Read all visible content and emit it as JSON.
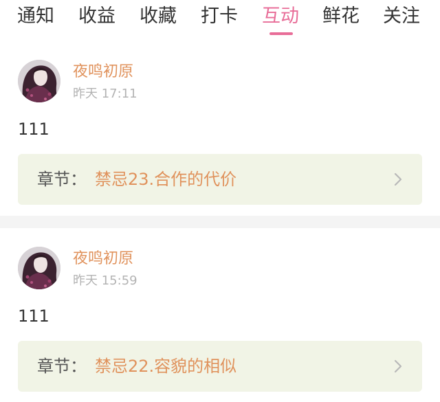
{
  "tabs": [
    {
      "label": "通知",
      "active": false
    },
    {
      "label": "收益",
      "active": false
    },
    {
      "label": "收藏",
      "active": false
    },
    {
      "label": "打卡",
      "active": false
    },
    {
      "label": "互动",
      "active": true
    },
    {
      "label": "鲜花",
      "active": false
    },
    {
      "label": "关注",
      "active": false
    }
  ],
  "colors": {
    "accent": "#e86d98",
    "username": "#e0925c",
    "chapter_title": "#e0925c",
    "chapter_bg": "#f1f4e6",
    "timestamp": "#b3b3b3"
  },
  "comments": [
    {
      "username": "夜鸣初原",
      "time": "昨天 17:11",
      "text": "111",
      "chapter_prefix": "章节：",
      "chapter_title": "禁忌23.合作的代价"
    },
    {
      "username": "夜鸣初原",
      "time": "昨天 15:59",
      "text": "111",
      "chapter_prefix": "章节：",
      "chapter_title": "禁忌22.容貌的相似"
    }
  ]
}
